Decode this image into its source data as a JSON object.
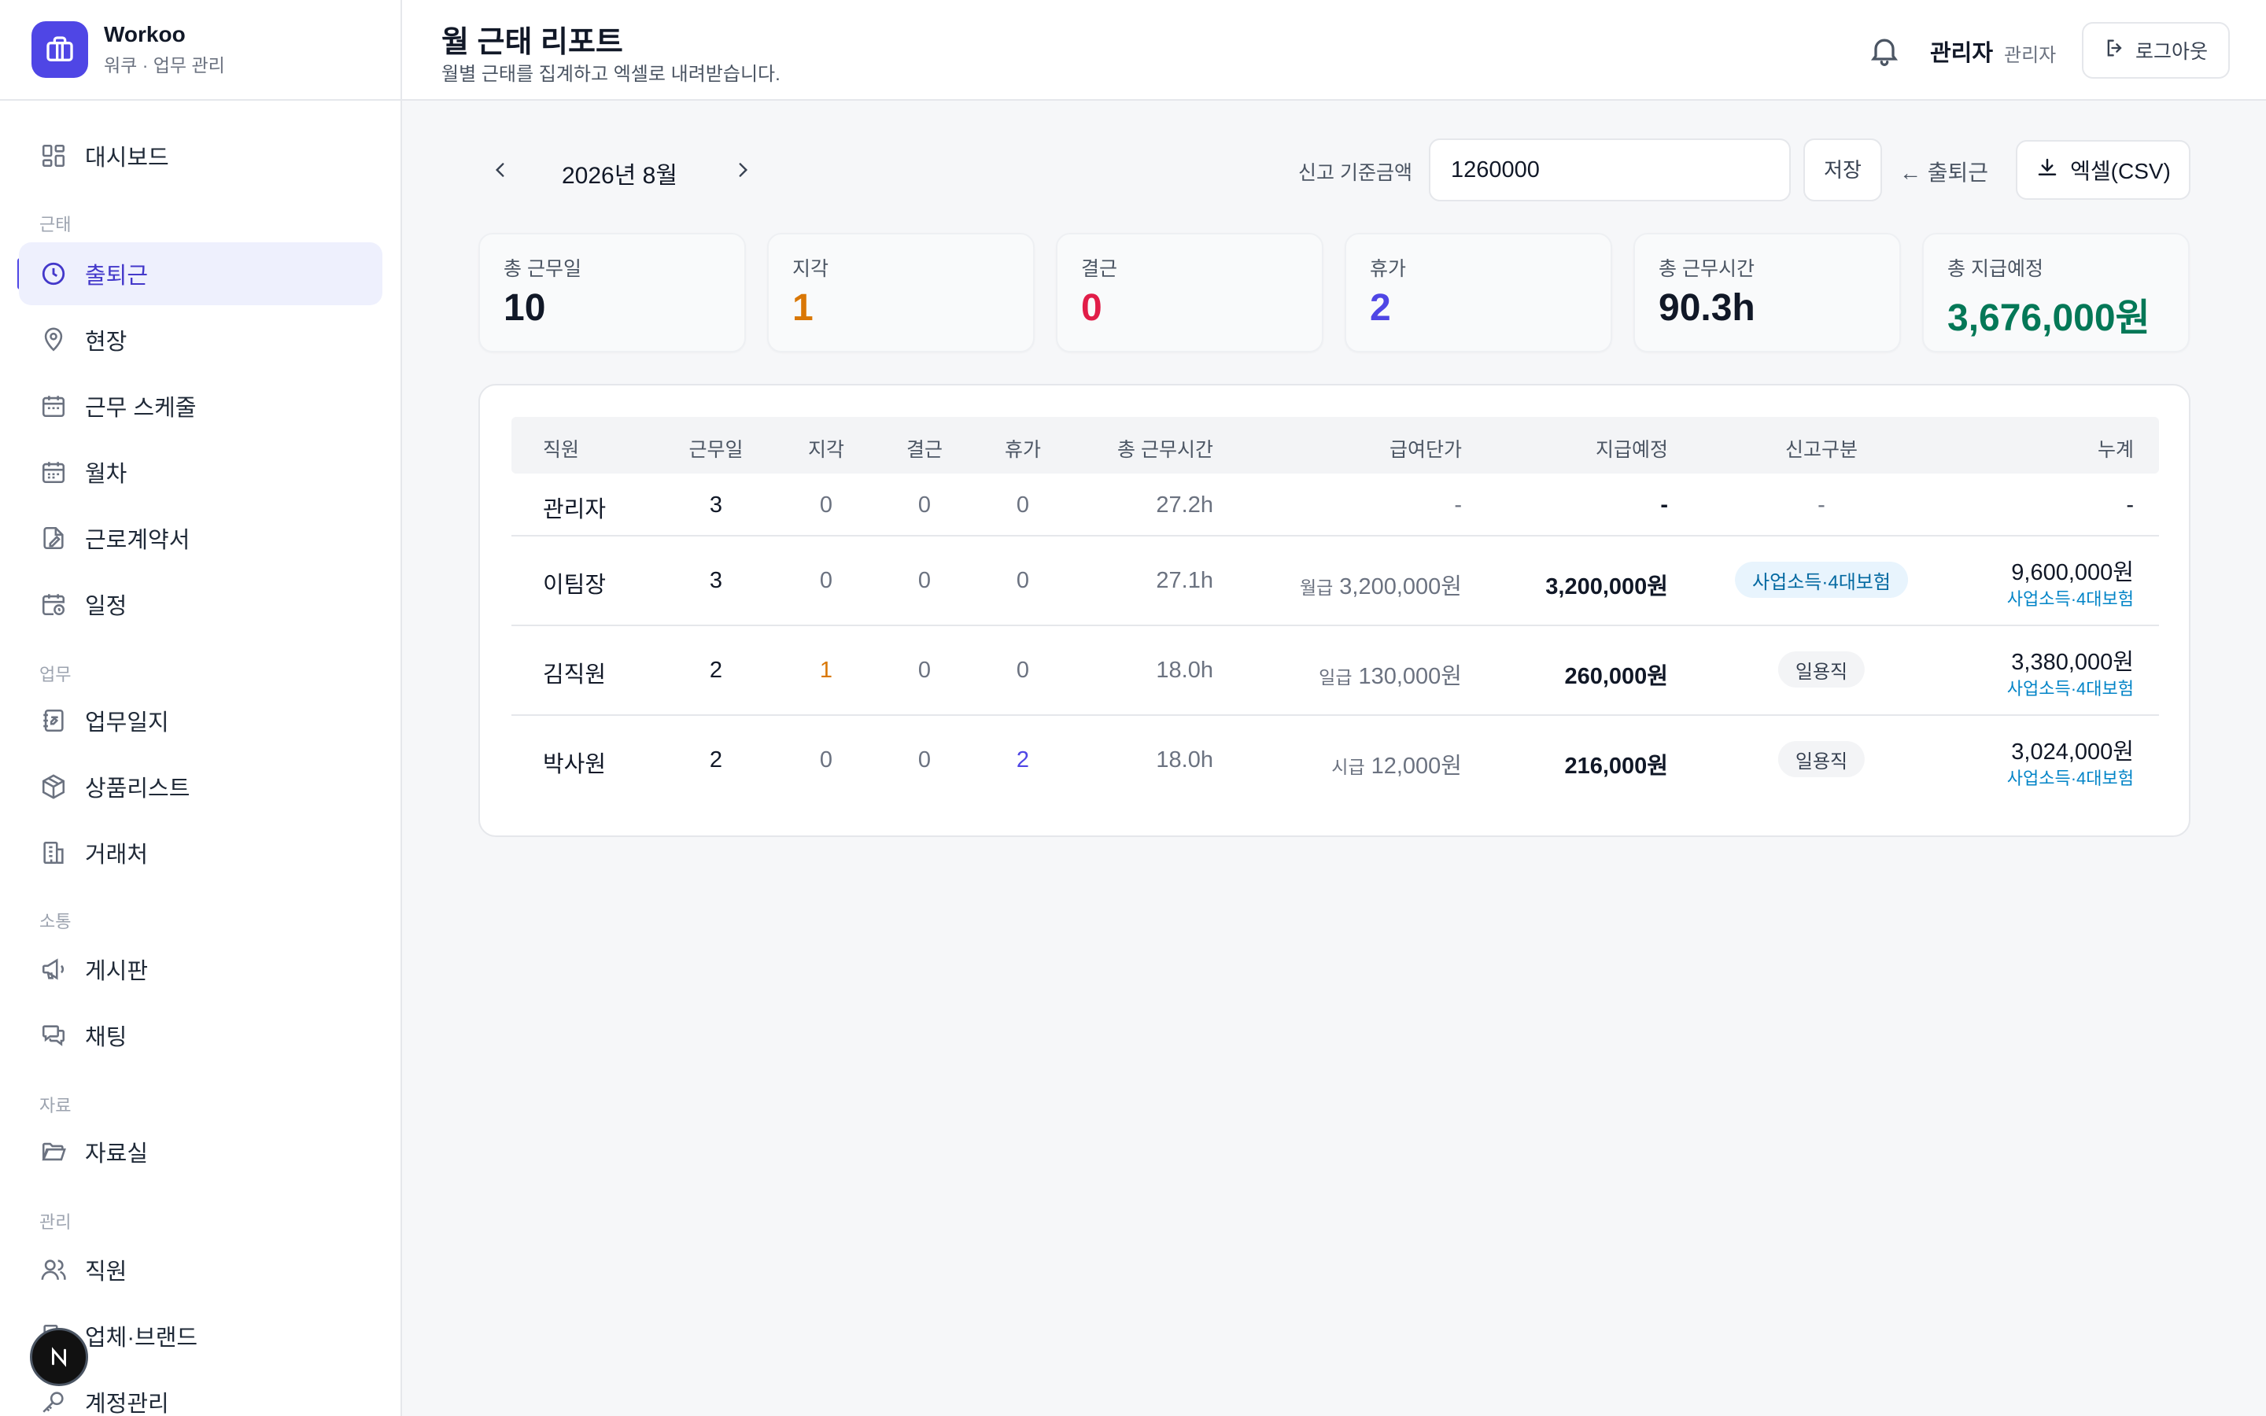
{
  "brand": {
    "name": "Workoo",
    "subtitle": "워쿠 · 업무 관리"
  },
  "sidebar": {
    "sections": {
      "attendance": "근태",
      "work": "업무",
      "comm": "소통",
      "data": "자료",
      "admin": "관리"
    },
    "items": {
      "dashboard": "대시보드",
      "attendance": "출퇴근",
      "site": "현장",
      "schedule": "근무 스케줄",
      "leave": "월차",
      "contract": "근로계약서",
      "calendar": "일정",
      "worklog": "업무일지",
      "products": "상품리스트",
      "clients": "거래처",
      "board": "게시판",
      "chat": "채팅",
      "library": "자료실",
      "staff": "직원",
      "company": "업체·브랜드",
      "accounts": "계정관리"
    }
  },
  "header": {
    "title": "월 근태 리포트",
    "subtitle": "월별 근태를 집계하고 엑셀로 내려받습니다.",
    "user_name": "관리자",
    "user_role": "관리자",
    "logout": "로그아웃"
  },
  "toolbar": {
    "month": "2026년 8월",
    "basis_label": "신고 기준금액",
    "basis_value": "1260000",
    "save": "저장",
    "back": "← 출퇴근",
    "csv": "엑셀(CSV)"
  },
  "stats": {
    "work_days": {
      "label": "총 근무일",
      "value": "10"
    },
    "late": {
      "label": "지각",
      "value": "1"
    },
    "absent": {
      "label": "결근",
      "value": "0"
    },
    "leave": {
      "label": "휴가",
      "value": "2"
    },
    "hours": {
      "label": "총 근무시간",
      "value": "90.3h"
    },
    "pay": {
      "label": "총 지급예정",
      "value": "3,676,000원"
    }
  },
  "table": {
    "headers": {
      "name": "직원",
      "days": "근무일",
      "late": "지각",
      "absent": "결근",
      "leave": "휴가",
      "hours": "총 근무시간",
      "unit": "급여단가",
      "pay": "지급예정",
      "type": "신고구분",
      "total": "누계"
    },
    "rows": [
      {
        "name": "관리자",
        "days": "3",
        "late": "0",
        "absent": "0",
        "leave": "0",
        "hours": "27.2h",
        "unit_kind": "",
        "unit": "-",
        "pay": "-",
        "type": "-",
        "total": "-",
        "total_sub": ""
      },
      {
        "name": "이팀장",
        "days": "3",
        "late": "0",
        "absent": "0",
        "leave": "0",
        "hours": "27.1h",
        "unit_kind": "월급",
        "unit": "3,200,000원",
        "pay": "3,200,000원",
        "type": "사업소득·4대보험",
        "total": "9,600,000원",
        "total_sub": "사업소득·4대보험"
      },
      {
        "name": "김직원",
        "days": "2",
        "late": "1",
        "absent": "0",
        "leave": "0",
        "hours": "18.0h",
        "unit_kind": "일급",
        "unit": "130,000원",
        "pay": "260,000원",
        "type": "일용직",
        "total": "3,380,000원",
        "total_sub": "사업소득·4대보험"
      },
      {
        "name": "박사원",
        "days": "2",
        "late": "0",
        "absent": "0",
        "leave": "2",
        "hours": "18.0h",
        "unit_kind": "시급",
        "unit": "12,000원",
        "pay": "216,000원",
        "type": "일용직",
        "total": "3,024,000원",
        "total_sub": "사업소득·4대보험"
      }
    ]
  },
  "colors": {
    "accent": "#4f46e5",
    "late": "#d97706",
    "absent": "#e11d48",
    "leave": "#4f46e5",
    "pay": "#047857",
    "link": "#0284c7"
  },
  "icons": [
    "briefcase-icon",
    "dashboard-icon",
    "clock-icon",
    "map-pin-icon",
    "calendar-icon",
    "file-signature-icon",
    "calendar-clock-icon",
    "notebook-icon",
    "package-icon",
    "building-icon",
    "megaphone-icon",
    "chat-icon",
    "folder-icon",
    "users-icon",
    "key-icon",
    "bell-icon",
    "logout-icon",
    "chevron-left-icon",
    "chevron-right-icon",
    "download-icon"
  ]
}
